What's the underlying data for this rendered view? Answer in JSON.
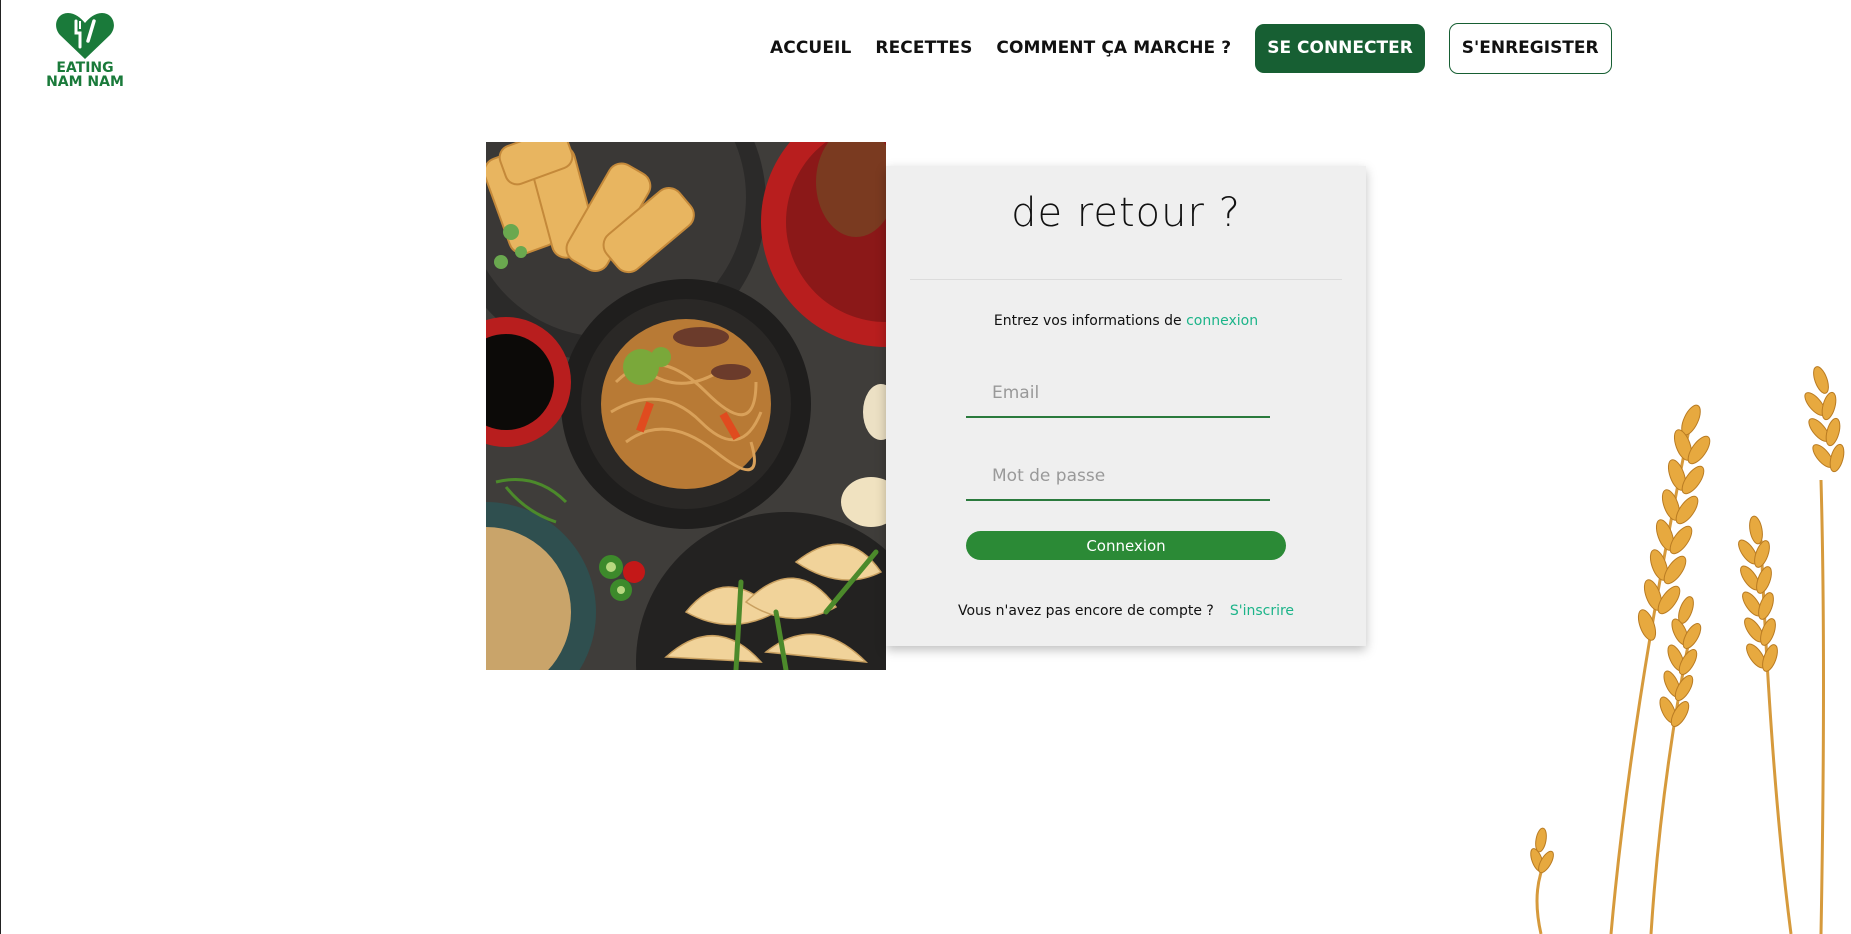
{
  "brand": {
    "name_line1": "EATING",
    "name_line2": "NAM NAM",
    "icon": "heart-fork-knife-icon",
    "color": "#1a7a3a"
  },
  "nav": {
    "home": "ACCUEIL",
    "recipes": "RECETTES",
    "how": "COMMENT ÇA MARCHE ?",
    "login": "SE CONNECTER",
    "register": "S'ENREGISTER"
  },
  "login": {
    "title": "de retour ?",
    "intro_prefix": "Entrez vos informations de",
    "intro_accent": "connexion",
    "email_placeholder": "Email",
    "password_placeholder": "Mot de passe",
    "submit_label": "Connexion",
    "no_account_text": "Vous n'avez pas encore de compte ?",
    "signup_link": "S'inscrire"
  },
  "colors": {
    "primary_dark": "#175f33",
    "primary": "#2b8a36",
    "accent": "#1cb489"
  },
  "images": {
    "food": "asian-food-platter-photo",
    "decoration": "wheat-stalks-illustration"
  }
}
